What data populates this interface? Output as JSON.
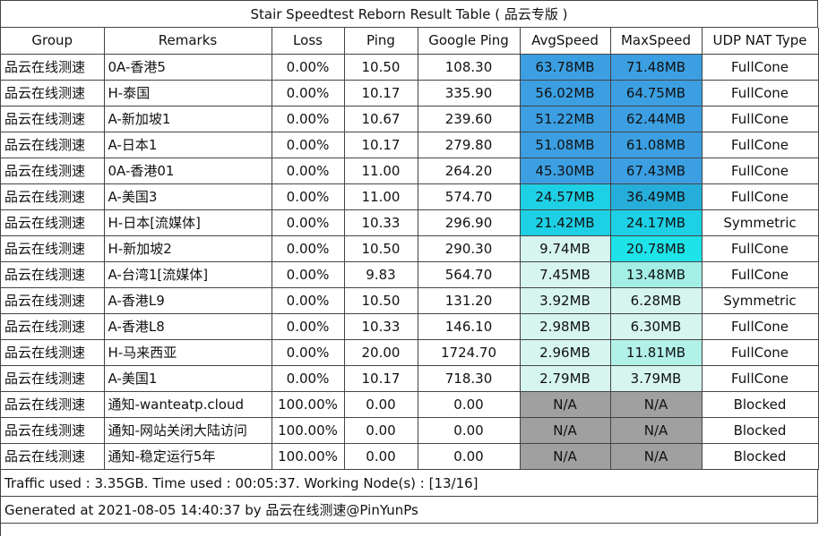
{
  "title": "Stair Speedtest Reborn Result Table ( 品云专版 )",
  "columns": [
    "Group",
    "Remarks",
    "Loss",
    "Ping",
    "Google Ping",
    "AvgSpeed",
    "MaxSpeed",
    "UDP NAT Type"
  ],
  "rows": [
    {
      "group": "品云在线测速",
      "remarks": "0A-香港5",
      "loss": "0.00%",
      "ping": "10.50",
      "gping": "108.30",
      "avg": "63.78MB",
      "max": "71.48MB",
      "nat": "FullCone",
      "avg_color": "#3b9fe2",
      "max_color": "#3b9fe2"
    },
    {
      "group": "品云在线测速",
      "remarks": "H-泰国",
      "loss": "0.00%",
      "ping": "10.17",
      "gping": "335.90",
      "avg": "56.02MB",
      "max": "64.75MB",
      "nat": "FullCone",
      "avg_color": "#3b9fe2",
      "max_color": "#3b9fe2"
    },
    {
      "group": "品云在线测速",
      "remarks": "A-新加坡1",
      "loss": "0.00%",
      "ping": "10.67",
      "gping": "239.60",
      "avg": "51.22MB",
      "max": "62.44MB",
      "nat": "FullCone",
      "avg_color": "#3b9fe2",
      "max_color": "#3b9fe2"
    },
    {
      "group": "品云在线测速",
      "remarks": "A-日本1",
      "loss": "0.00%",
      "ping": "10.17",
      "gping": "279.80",
      "avg": "51.08MB",
      "max": "61.08MB",
      "nat": "FullCone",
      "avg_color": "#3b9fe2",
      "max_color": "#3b9fe2"
    },
    {
      "group": "品云在线测速",
      "remarks": "0A-香港01",
      "loss": "0.00%",
      "ping": "11.00",
      "gping": "264.20",
      "avg": "45.30MB",
      "max": "67.43MB",
      "nat": "FullCone",
      "avg_color": "#3b9fe2",
      "max_color": "#3b9fe2"
    },
    {
      "group": "品云在线测速",
      "remarks": "A-美国3",
      "loss": "0.00%",
      "ping": "11.00",
      "gping": "574.70",
      "avg": "24.57MB",
      "max": "36.49MB",
      "nat": "FullCone",
      "avg_color": "#1dd0e5",
      "max_color": "#26aedb"
    },
    {
      "group": "品云在线测速",
      "remarks": "H-日本[流媒体]",
      "loss": "0.00%",
      "ping": "10.33",
      "gping": "296.90",
      "avg": "21.42MB",
      "max": "24.17MB",
      "nat": "Symmetric",
      "avg_color": "#1dd0e5",
      "max_color": "#1dd0e5"
    },
    {
      "group": "品云在线测速",
      "remarks": "H-新加坡2",
      "loss": "0.00%",
      "ping": "10.50",
      "gping": "290.30",
      "avg": "9.74MB",
      "max": "20.78MB",
      "nat": "FullCone",
      "avg_color": "#d6f5ef",
      "max_color": "#1ee3e9"
    },
    {
      "group": "品云在线测速",
      "remarks": "A-台湾1[流媒体]",
      "loss": "0.00%",
      "ping": "9.83",
      "gping": "564.70",
      "avg": "7.45MB",
      "max": "13.48MB",
      "nat": "FullCone",
      "avg_color": "#d6f5ef",
      "max_color": "#a3eee5"
    },
    {
      "group": "品云在线测速",
      "remarks": "A-香港L9",
      "loss": "0.00%",
      "ping": "10.50",
      "gping": "131.20",
      "avg": "3.92MB",
      "max": "6.28MB",
      "nat": "Symmetric",
      "avg_color": "#d6f5ef",
      "max_color": "#d6f5ef"
    },
    {
      "group": "品云在线测速",
      "remarks": "A-香港L8",
      "loss": "0.00%",
      "ping": "10.33",
      "gping": "146.10",
      "avg": "2.98MB",
      "max": "6.30MB",
      "nat": "FullCone",
      "avg_color": "#d6f5ef",
      "max_color": "#d6f5ef"
    },
    {
      "group": "品云在线测速",
      "remarks": "H-马来西亚",
      "loss": "0.00%",
      "ping": "20.00",
      "gping": "1724.70",
      "avg": "2.96MB",
      "max": "11.81MB",
      "nat": "FullCone",
      "avg_color": "#d6f5ef",
      "max_color": "#b1f1e8"
    },
    {
      "group": "品云在线测速",
      "remarks": "A-美国1",
      "loss": "0.00%",
      "ping": "10.17",
      "gping": "718.30",
      "avg": "2.79MB",
      "max": "3.79MB",
      "nat": "FullCone",
      "avg_color": "#d6f5ef",
      "max_color": "#d6f5ef"
    },
    {
      "group": "品云在线测速",
      "remarks": "通知-wanteatp.cloud",
      "loss": "100.00%",
      "ping": "0.00",
      "gping": "0.00",
      "avg": "N/A",
      "max": "N/A",
      "nat": "Blocked",
      "avg_color": "#a0a0a0",
      "max_color": "#a0a0a0"
    },
    {
      "group": "品云在线测速",
      "remarks": "通知-网站关闭大陆访问",
      "loss": "100.00%",
      "ping": "0.00",
      "gping": "0.00",
      "avg": "N/A",
      "max": "N/A",
      "nat": "Blocked",
      "avg_color": "#a0a0a0",
      "max_color": "#a0a0a0"
    },
    {
      "group": "品云在线测速",
      "remarks": "通知-稳定运行5年",
      "loss": "100.00%",
      "ping": "0.00",
      "gping": "0.00",
      "avg": "N/A",
      "max": "N/A",
      "nat": "Blocked",
      "avg_color": "#a0a0a0",
      "max_color": "#a0a0a0"
    }
  ],
  "footer": {
    "traffic": "Traffic used : 3.35GB. Time used : 00:05:37. Working Node(s) : [13/16]",
    "generated": "Generated at 2021-08-05 14:40:37 by 品云在线测速@PinYunPs"
  }
}
